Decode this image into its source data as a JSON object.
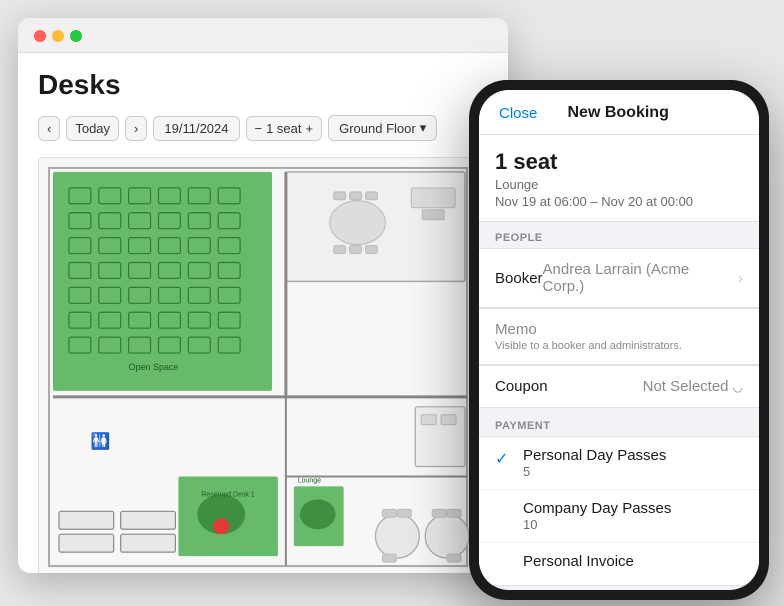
{
  "window": {
    "title": "Desks",
    "toolbar": {
      "prev_label": "‹",
      "next_label": "›",
      "today_label": "Today",
      "date_value": "19/11/2024",
      "seats_value": "1 seat",
      "seats_minus": "−",
      "seats_plus": "+",
      "floor_label": "Ground Floor",
      "floor_chevron": "▾"
    }
  },
  "mobile": {
    "nav": {
      "close_label": "Close",
      "title": "New Booking"
    },
    "booking": {
      "title": "1 seat",
      "subtitle": "Lounge",
      "date_range": "Nov 19 at 06:00 – Nov 20 at 00:00"
    },
    "people_section": "PEOPLE",
    "booker": {
      "label": "Booker",
      "value": "Andrea Larrain (Acme Corp.)",
      "chevron": "›"
    },
    "memo": {
      "placeholder": "Memo",
      "hint": "Visible to a booker and administrators."
    },
    "coupon": {
      "label": "Coupon",
      "value": "Not Selected",
      "chevron": "◡"
    },
    "payment_section": "PAYMENT",
    "payment_options": [
      {
        "name": "Personal Day Passes",
        "count": "5",
        "selected": true
      },
      {
        "name": "Company Day Passes",
        "count": "10",
        "selected": false
      },
      {
        "name": "Personal Invoice",
        "count": "",
        "selected": false
      }
    ]
  },
  "colors": {
    "accent": "#007AFF",
    "green_zone": "#4CAF50",
    "red_zone": "#e53935",
    "wall": "#888",
    "desk_stroke": "#4CAF50"
  }
}
